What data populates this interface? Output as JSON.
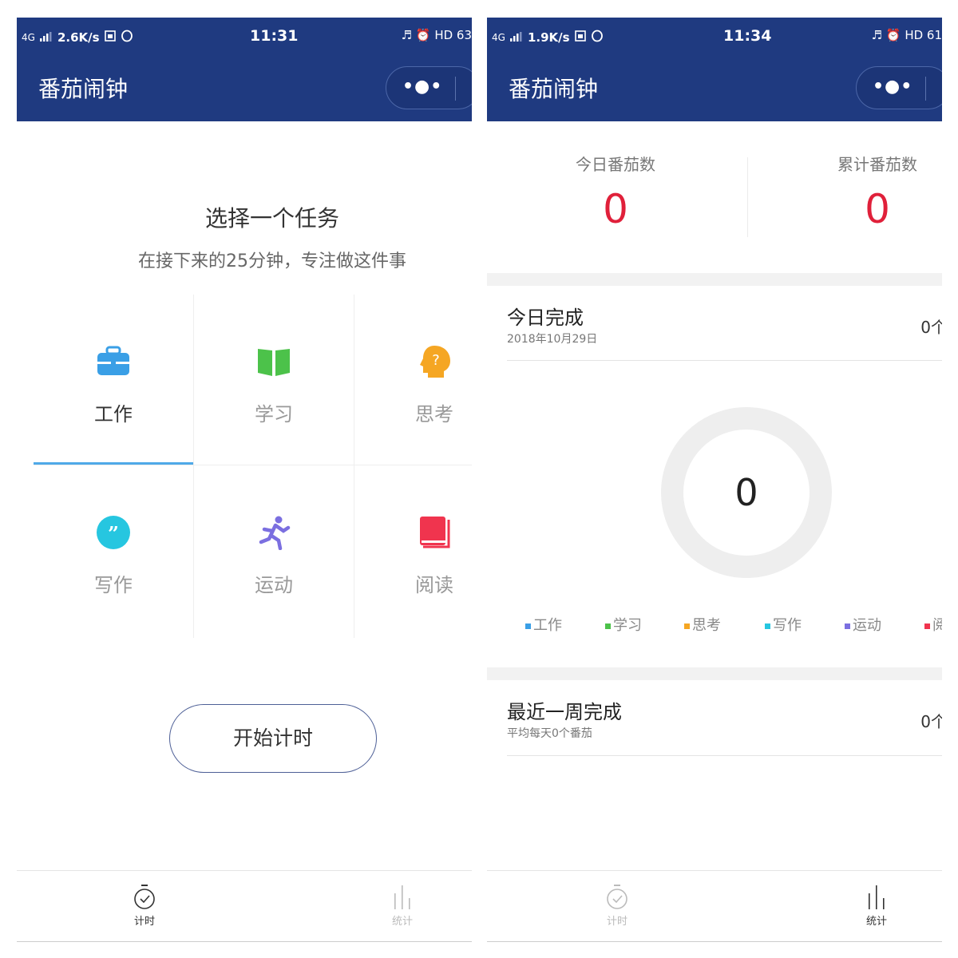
{
  "left_screen": {
    "status_bar": {
      "network": "4G",
      "speed": "2.6K/s",
      "time": "11:31",
      "right": "HD 63"
    },
    "nav": {
      "title": "番茄闹钟",
      "menu_dots": "•●•"
    },
    "heading": "选择一个任务",
    "subheading": "在接下来的25分钟，专注做这件事",
    "tasks": [
      {
        "label": "工作",
        "icon": "briefcase-icon",
        "color": "#3a9fe6",
        "active": true
      },
      {
        "label": "学习",
        "icon": "book-icon",
        "color": "#4cc24a",
        "active": false
      },
      {
        "label": "思考",
        "icon": "thinking-head-icon",
        "color": "#f5a623",
        "active": false
      },
      {
        "label": "写作",
        "icon": "quote-icon",
        "color": "#26c6e0",
        "active": false
      },
      {
        "label": "运动",
        "icon": "running-icon",
        "color": "#7b6fe0",
        "active": false
      },
      {
        "label": "阅读",
        "icon": "reading-book-icon",
        "color": "#f0344e",
        "active": false
      }
    ],
    "start_button": "开始计时",
    "tabbar": {
      "timer_label": "计时",
      "stats_label": "统计",
      "active": "timer"
    }
  },
  "right_screen": {
    "status_bar": {
      "network": "4G",
      "speed": "1.9K/s",
      "time": "11:34",
      "right": "HD 61"
    },
    "nav": {
      "title": "番茄闹钟",
      "menu_dots": "•●•"
    },
    "today_tomatoes": {
      "label": "今日番茄数",
      "value": "0"
    },
    "total_tomatoes": {
      "label": "累计番茄数",
      "value": "0"
    },
    "today_done": {
      "title": "今日完成",
      "date": "2018年10月29日",
      "count": "0个"
    },
    "donut_value": "0",
    "legend": [
      {
        "label": "工作",
        "color": "#3a9fe6"
      },
      {
        "label": "学习",
        "color": "#4cc24a"
      },
      {
        "label": "思考",
        "color": "#f5a623"
      },
      {
        "label": "写作",
        "color": "#26c6e0"
      },
      {
        "label": "运动",
        "color": "#7b6fe0"
      },
      {
        "label": "阅",
        "color": "#f0344e"
      }
    ],
    "week_done": {
      "title": "最近一周完成",
      "sub": "平均每天0个番茄",
      "count": "0个"
    },
    "tabbar": {
      "timer_label": "计时",
      "stats_label": "统计",
      "active": "stats"
    }
  }
}
